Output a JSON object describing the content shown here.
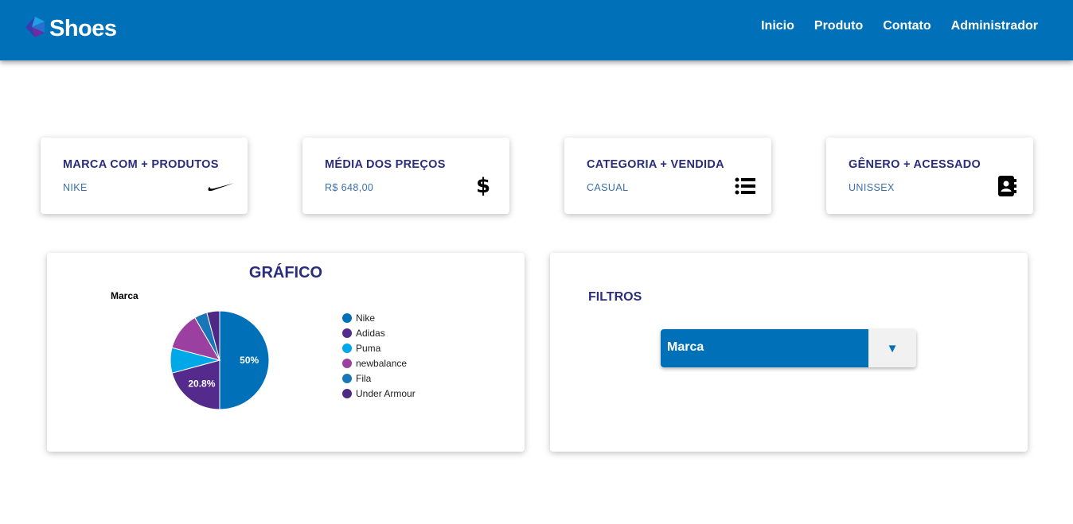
{
  "brand": {
    "name": "Shoes",
    "logo_icon": "shoe-logo-icon"
  },
  "nav": {
    "items": [
      "Inicio",
      "Produto",
      "Contato",
      "Administrador"
    ]
  },
  "cards": [
    {
      "title": "MARCA COM + PRODUTOS",
      "value": "NIKE",
      "icon": "nike-swoosh-icon"
    },
    {
      "title": "MÉDIA DOS PREÇOS",
      "value": "R$ 648,00",
      "icon": "dollar-icon"
    },
    {
      "title": "CATEGORIA + VENDIDA",
      "value": "CASUAL",
      "icon": "list-icon"
    },
    {
      "title": "GÊNERO + ACESSADO",
      "value": "UNISSEX",
      "icon": "contact-book-icon"
    }
  ],
  "chart_panel": {
    "title": "GRÁFICO"
  },
  "chart_data": {
    "type": "pie",
    "title": "Marca",
    "categories": [
      "Nike",
      "Adidas",
      "Puma",
      "newbalance",
      "Fila",
      "Under Armour"
    ],
    "values": [
      50,
      20.8,
      8.3,
      12.5,
      4.2,
      4.2
    ],
    "labels_shown": [
      "50%",
      "20.8%",
      "",
      "",
      "",
      ""
    ],
    "colors": [
      "#0070b8",
      "#542a8c",
      "#00a8e8",
      "#9b3fa0",
      "#1976b8",
      "#4e2a84"
    ],
    "legend": "right"
  },
  "filters": {
    "title": "FILTROS",
    "select": {
      "selected": "Marca",
      "arrow_icon": "triangle-down-icon"
    }
  },
  "colors": {
    "primary": "#0070b8",
    "heading": "#2a2d7c",
    "value_text": "#3b6fa8"
  }
}
